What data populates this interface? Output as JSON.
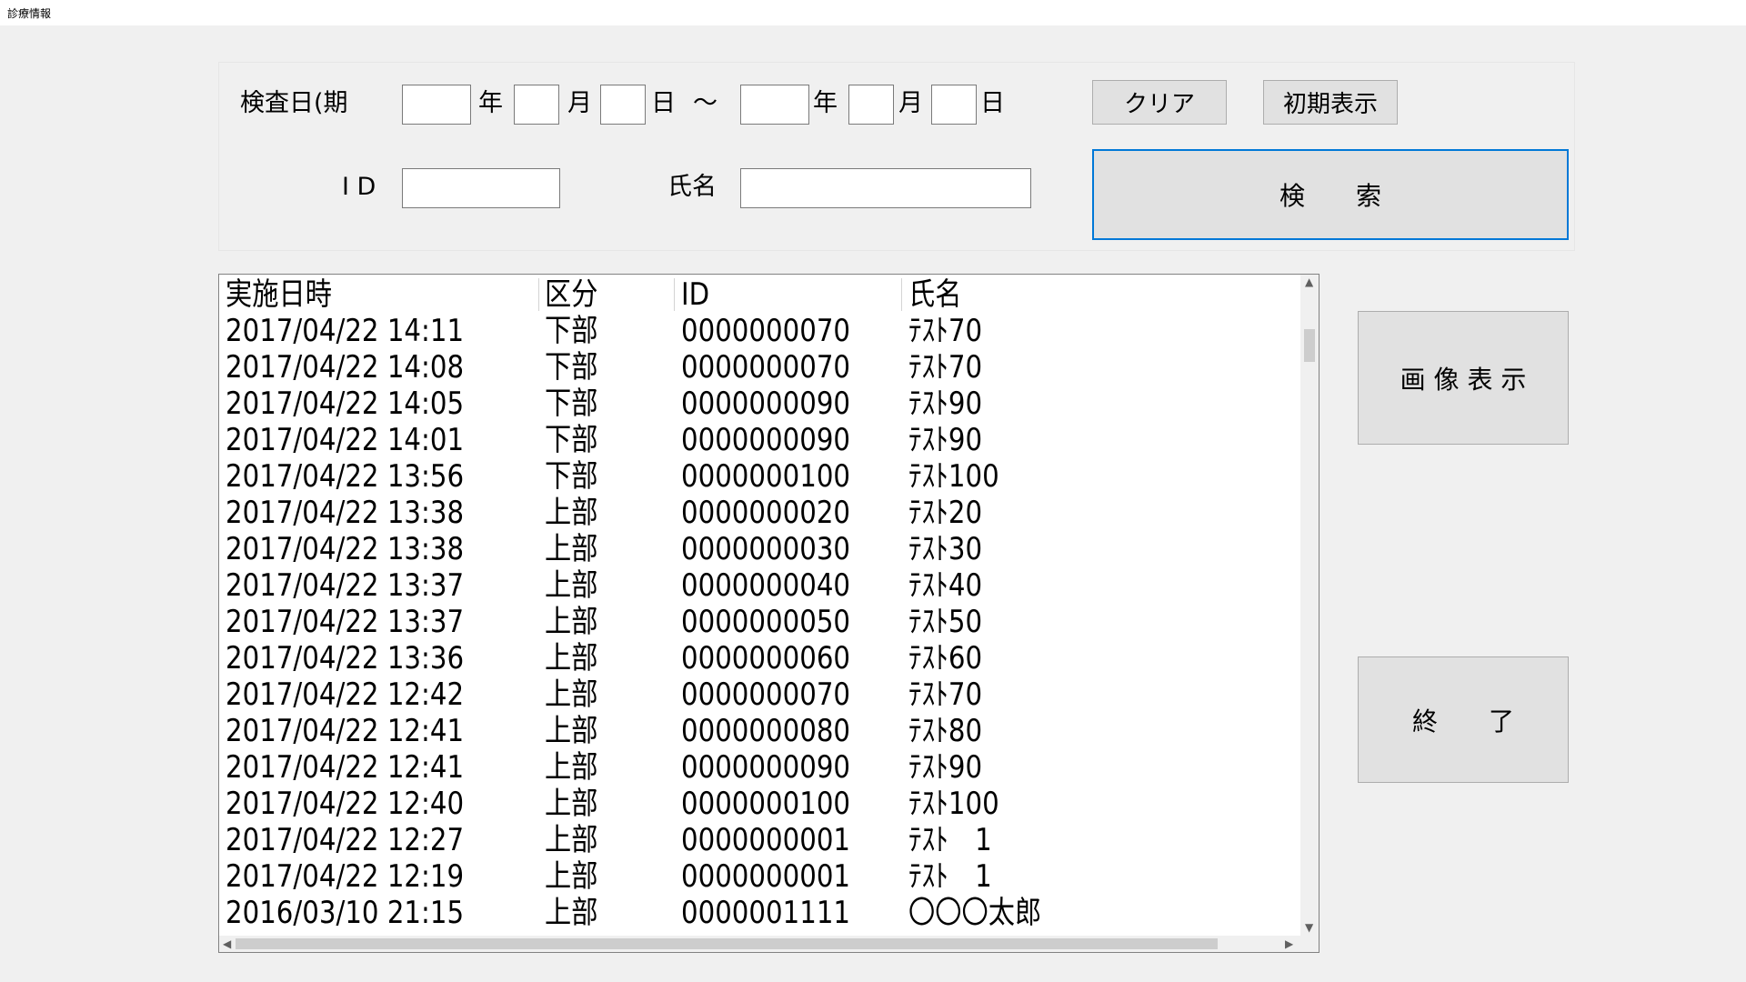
{
  "window": {
    "title": "診療情報"
  },
  "search": {
    "date_label": "検査日(期",
    "year": "年",
    "month": "月",
    "day": "日",
    "tilde": "〜",
    "id_label": "I D",
    "name_label": "氏名",
    "from_year": "",
    "from_month": "",
    "from_day": "",
    "to_year": "",
    "to_month": "",
    "to_day": "",
    "id_value": "",
    "name_value": ""
  },
  "buttons": {
    "clear": "クリア",
    "initial_display": "初期表示",
    "search": "検　　索",
    "image_display": "画 像 表 示",
    "exit": "終　　了"
  },
  "list": {
    "headers": [
      "実施日時",
      "区分",
      "ID",
      "氏名"
    ],
    "rows": [
      [
        "2017/04/22 14:11",
        "下部",
        "0000000070",
        "ﾃｽﾄ70"
      ],
      [
        "2017/04/22 14:08",
        "下部",
        "0000000070",
        "ﾃｽﾄ70"
      ],
      [
        "2017/04/22 14:05",
        "下部",
        "0000000090",
        "ﾃｽﾄ90"
      ],
      [
        "2017/04/22 14:01",
        "下部",
        "0000000090",
        "ﾃｽﾄ90"
      ],
      [
        "2017/04/22 13:56",
        "下部",
        "0000000100",
        "ﾃｽﾄ100"
      ],
      [
        "2017/04/22 13:38",
        "上部",
        "0000000020",
        "ﾃｽﾄ20"
      ],
      [
        "2017/04/22 13:38",
        "上部",
        "0000000030",
        "ﾃｽﾄ30"
      ],
      [
        "2017/04/22 13:37",
        "上部",
        "0000000040",
        "ﾃｽﾄ40"
      ],
      [
        "2017/04/22 13:37",
        "上部",
        "0000000050",
        "ﾃｽﾄ50"
      ],
      [
        "2017/04/22 13:36",
        "上部",
        "0000000060",
        "ﾃｽﾄ60"
      ],
      [
        "2017/04/22 12:42",
        "上部",
        "0000000070",
        "ﾃｽﾄ70"
      ],
      [
        "2017/04/22 12:41",
        "上部",
        "0000000080",
        "ﾃｽﾄ80"
      ],
      [
        "2017/04/22 12:41",
        "上部",
        "0000000090",
        "ﾃｽﾄ90"
      ],
      [
        "2017/04/22 12:40",
        "上部",
        "0000000100",
        "ﾃｽﾄ100"
      ],
      [
        "2017/04/22 12:27",
        "上部",
        "0000000001",
        "ﾃｽﾄ　1"
      ],
      [
        "2017/04/22 12:19",
        "上部",
        "0000000001",
        "ﾃｽﾄ　1"
      ],
      [
        "2016/03/10 21:15",
        "上部",
        "0000001111",
        "〇〇〇太郎"
      ]
    ]
  },
  "icons": {
    "scroll_up": "chevron-up-icon",
    "scroll_down": "chevron-down-icon",
    "scroll_left": "chevron-left-icon",
    "scroll_right": "chevron-right-icon"
  },
  "colors": {
    "focus_border": "#0078d7",
    "button_face": "#e1e1e1",
    "window_bg": "#f0f0f0"
  }
}
